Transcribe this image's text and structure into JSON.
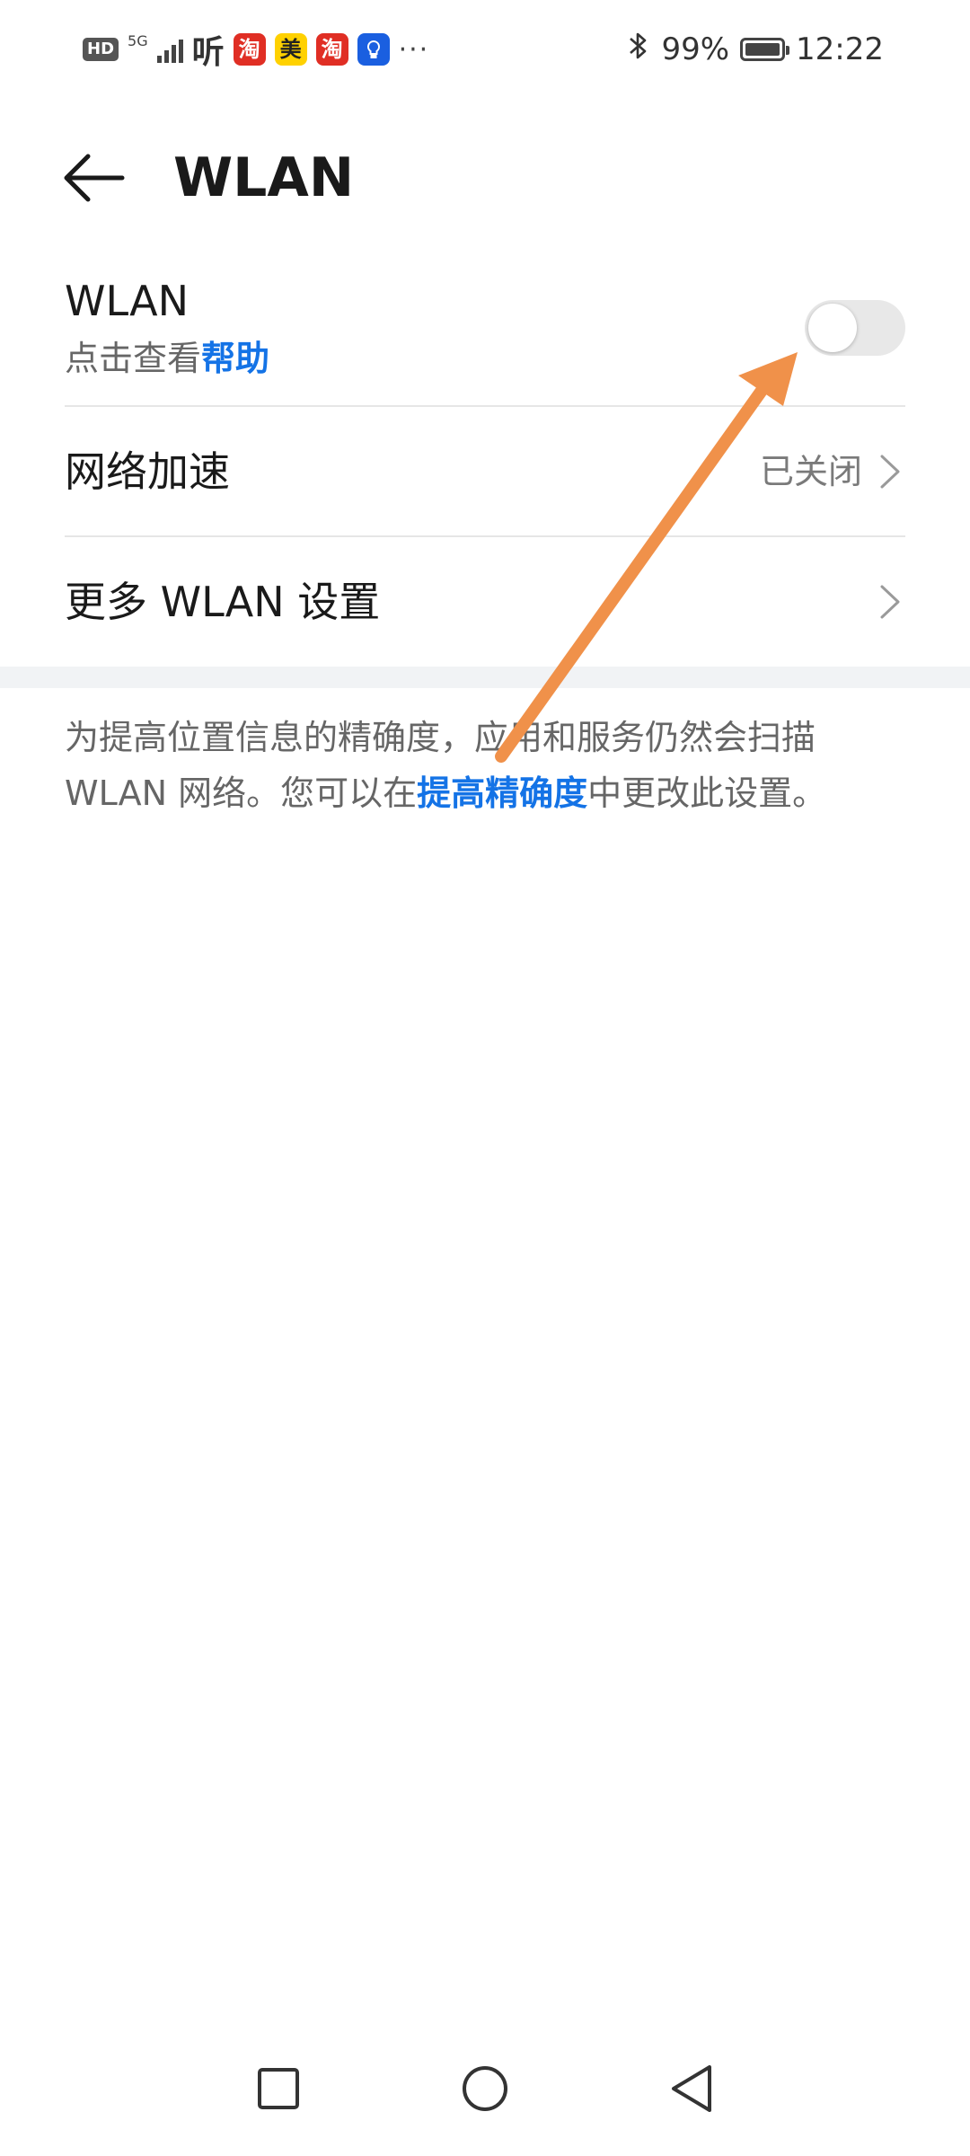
{
  "status_bar": {
    "left_badge": "HD",
    "network": "5G",
    "app_ting": "听",
    "app_tao": "淘",
    "app_mei": "美",
    "more": "···",
    "battery": "99%",
    "time": "12:22"
  },
  "header": {
    "title": "WLAN"
  },
  "wlan_row": {
    "title": "WLAN",
    "subtitle_prefix": "点击查看",
    "subtitle_link": "帮助",
    "toggle_on": false
  },
  "accel_row": {
    "title": "网络加速",
    "value": "已关闭"
  },
  "more_row": {
    "title": "更多 WLAN 设置"
  },
  "note": {
    "text_before": "为提高位置信息的精确度，应用和服务仍然会扫描 WLAN 网络。您可以在",
    "link": "提高精确度",
    "text_after": "中更改此设置。"
  },
  "colors": {
    "link": "#1473e6",
    "annotation_arrow": "#f0914a"
  },
  "navbar": {
    "buttons": [
      "recent-apps",
      "home",
      "back"
    ]
  }
}
